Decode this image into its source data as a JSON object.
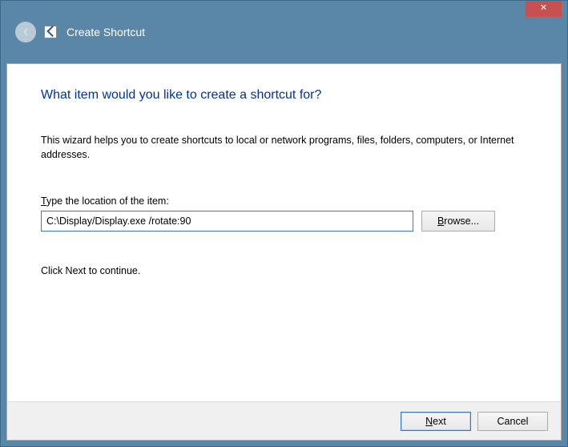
{
  "window": {
    "title": "Create Shortcut",
    "close_glyph": "✕"
  },
  "wizard": {
    "heading": "What item would you like to create a shortcut for?",
    "description": "This wizard helps you to create shortcuts to local or network programs, files, folders, computers, or Internet addresses.",
    "location_label_pre": "T",
    "location_label_rest": "ype the location of the item:",
    "location_value": "C:\\Display/Display.exe /rotate:90",
    "browse_pre": "B",
    "browse_rest": "rowse...",
    "continue_text": "Click Next to continue."
  },
  "footer": {
    "next_pre": "N",
    "next_rest": "ext",
    "cancel": "Cancel"
  }
}
